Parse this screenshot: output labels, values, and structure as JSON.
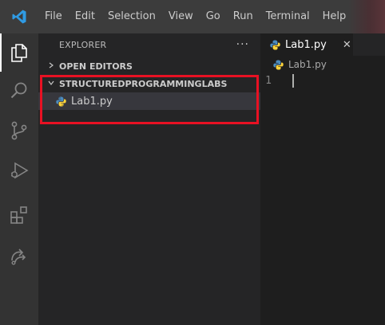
{
  "menu": {
    "items": [
      "File",
      "Edit",
      "Selection",
      "View",
      "Go",
      "Run",
      "Terminal",
      "Help"
    ]
  },
  "explorer": {
    "title": "EXPLORER",
    "more_label": "···",
    "sections": {
      "open_editors": "OPEN EDITORS",
      "folder": "STRUCTUREDPROGRAMMINGLABS"
    },
    "files": [
      {
        "name": "Lab1.py",
        "icon": "python-icon"
      }
    ]
  },
  "editor": {
    "tab": {
      "label": "Lab1.py",
      "close": "✕"
    },
    "breadcrumb": "Lab1.py",
    "lines": [
      {
        "number": "1",
        "text": ""
      }
    ]
  },
  "colors": {
    "accent_highlight": "#e81123",
    "python_blue": "#4b8bbe",
    "python_yellow": "#ffd43b"
  }
}
